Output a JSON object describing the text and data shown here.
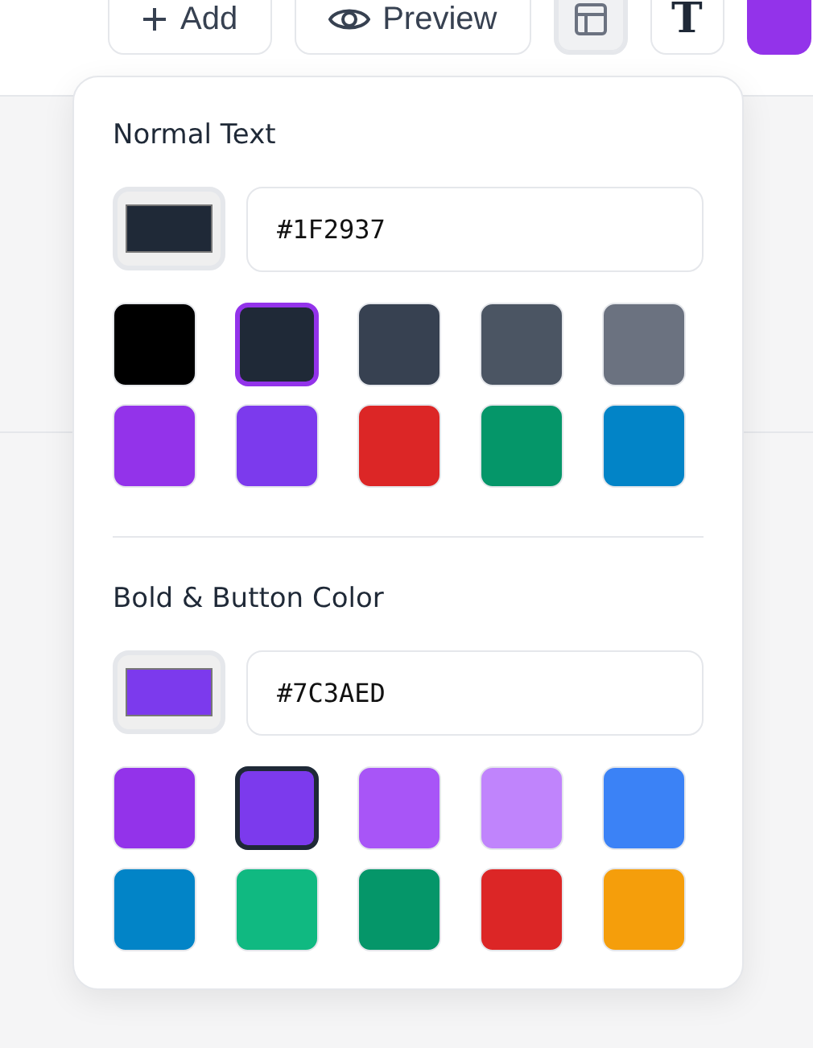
{
  "toolbar": {
    "buttons": [
      {
        "kind": "add",
        "label": "Add",
        "selected": false
      },
      {
        "kind": "preview",
        "label": "Preview",
        "selected": false
      },
      {
        "kind": "layout",
        "selected": true
      },
      {
        "kind": "font",
        "label": "T",
        "selected": false
      },
      {
        "kind": "primary",
        "selected": false
      }
    ]
  },
  "popover": {
    "sections": [
      {
        "title": "Normal Text",
        "value": "#1F2937",
        "color": "#1F2937",
        "selection_ring": {
          "color": "#9333EA"
        },
        "colors": [
          {
            "color": "#000000",
            "selected": false
          },
          {
            "color": "#1F2937",
            "selected": true
          },
          {
            "color": "#374151",
            "selected": false
          },
          {
            "color": "#4B5563",
            "selected": false
          },
          {
            "color": "#6B7280",
            "selected": false
          },
          {
            "color": "#9333EA",
            "selected": false
          },
          {
            "color": "#7C3AED",
            "selected": false
          },
          {
            "color": "#DC2626",
            "selected": false
          },
          {
            "color": "#059669",
            "selected": false
          },
          {
            "color": "#0284C7",
            "selected": false
          }
        ]
      },
      {
        "title": "Bold & Button Color",
        "value": "#7C3AED",
        "color": "#7C3AED",
        "selection_ring": {
          "color": "#1F2937"
        },
        "colors": [
          {
            "color": "#9333EA",
            "selected": false
          },
          {
            "color": "#7C3AED",
            "selected": true
          },
          {
            "color": "#A855F7",
            "selected": false
          },
          {
            "color": "#C084FC",
            "selected": false
          },
          {
            "color": "#3B82F6",
            "selected": false
          },
          {
            "color": "#0284C7",
            "selected": false
          },
          {
            "color": "#10B981",
            "selected": false
          },
          {
            "color": "#059669",
            "selected": false
          },
          {
            "color": "#DC2626",
            "selected": false
          },
          {
            "color": "#F59E0B",
            "selected": false
          }
        ]
      }
    ]
  }
}
